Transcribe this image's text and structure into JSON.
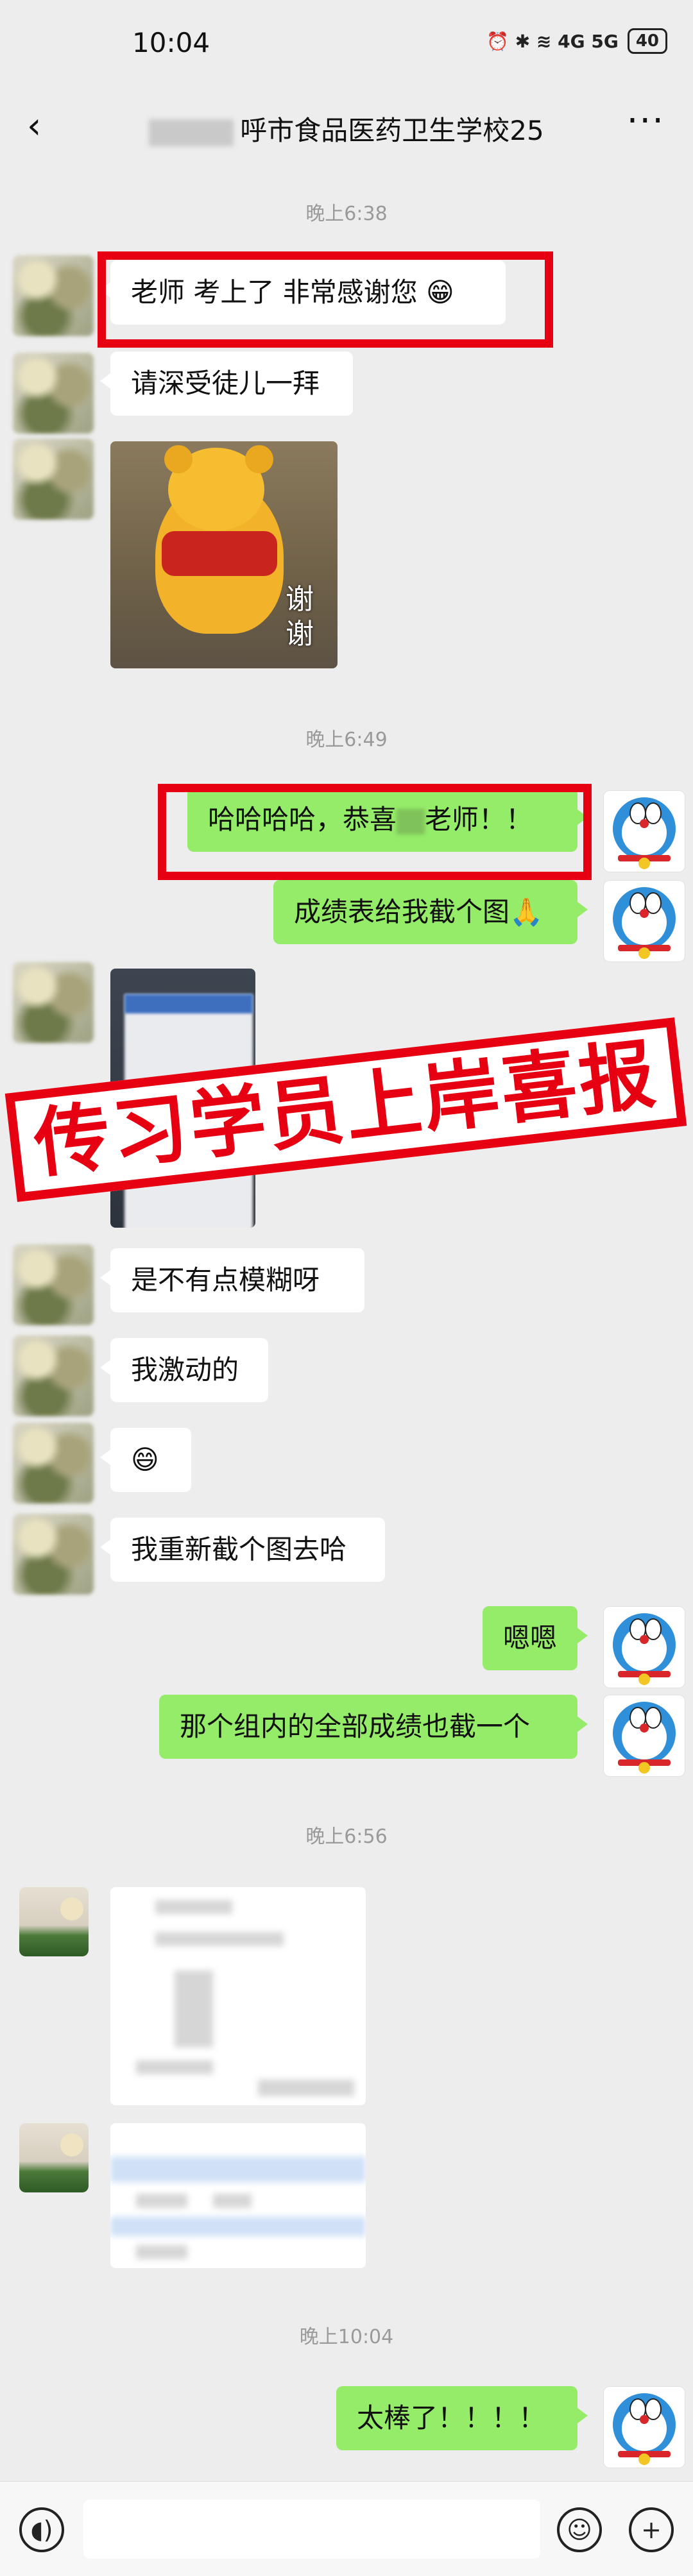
{
  "status": {
    "time": "10:04",
    "icons_text": "⏰ ✱ ≋ 4G 5G",
    "battery": "40"
  },
  "header": {
    "title": "呼市食品医药卫生学校25",
    "more": "···"
  },
  "timestamps": [
    "晚上6:38",
    "晚上6:49",
    "晚上6:56",
    "晚上10:04"
  ],
  "messages": {
    "m1": "老师 考上了 非常感谢您 😁",
    "m2": "请深受徒儿一拜",
    "m3_caption": "谢\n谢",
    "m4_a": "哈哈哈哈，恭喜",
    "m4_b": "老师！！",
    "m5": "成绩表给我截个图🙏",
    "m6": "是不有点模糊呀",
    "m7": "我激动的",
    "m8": "😄",
    "m9": "我重新截个图去哈",
    "m10": "嗯嗯",
    "m11": "那个组内的全部成绩也截一个",
    "m12": "太棒了！！！！"
  },
  "banner_text": "传习学员上岸喜报",
  "icons": {
    "back": "chevron-left-icon",
    "voice": "voice-icon",
    "emoji": "emoji-icon",
    "plus": "plus-icon"
  }
}
